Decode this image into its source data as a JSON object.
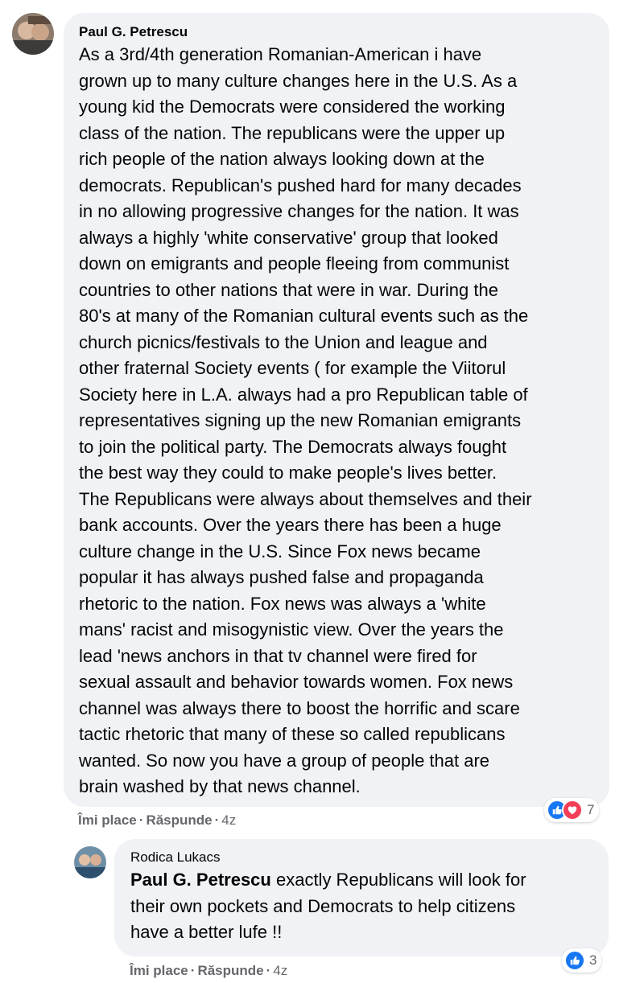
{
  "comment": {
    "author": "Paul G. Petrescu",
    "text": "As a 3rd/4th generation Romanian-American i have\ngrown up to many culture changes here in the U.S. As a\nyoung kid the Democrats were considered the working\nclass of the nation. The republicans were the upper up\nrich people of the nation always looking down at the\ndemocrats. Republican's pushed hard for many decades\nin no allowing progressive changes for the nation. It was\nalways a highly 'white conservative' group that looked\ndown on emigrants and people fleeing from communist\ncountries to other nations that were in war. During the\n80's at many of the Romanian cultural events such as the\nchurch picnics/festivals to the Union and league and\nother fraternal Society events ( for example the Viitorul\nSociety here in L.A. always had a pro Republican table of\nrepresentatives signing up the new Romanian emigrants\nto join the political party. The Democrats always fought\nthe best way they could to make people's lives better.\nThe Republicans were always about themselves and their\nbank accounts. Over the years there has been a huge\nculture change in the U.S. Since Fox news became\npopular it has always pushed false and propaganda\nrhetoric to the nation. Fox news was always a 'white\nmans' racist and misogynistic view. Over the years the\nlead 'news anchors in that tv channel were fired for\nsexual assault and behavior towards women. Fox news\nchannel was always there to boost the horrific and scare\ntactic rhetoric that many of these so called republicans\nwanted. So now you have a group of people that are\nbrain washed by that news channel.",
    "like_label": "Îmi place",
    "reply_label": "Răspunde",
    "time": "4z",
    "reaction_count": "7",
    "reaction_icons": [
      "like-icon",
      "love-icon"
    ]
  },
  "reply": {
    "author": "Rodica Lukacs",
    "mention": "Paul G. Petrescu",
    "text": " exactly Republicans will look for\ntheir own pockets and Democrats to help citizens\nhave a better lufe !!",
    "like_label": "Îmi place",
    "reply_label": "Răspunde",
    "time": "4z",
    "reaction_count": "3",
    "reaction_icons": [
      "like-icon"
    ]
  },
  "colors": {
    "bubble": "#f0f2f5",
    "meta_text": "#65676b",
    "like_blue": "#1877f2",
    "love_red": "#f33e58"
  }
}
